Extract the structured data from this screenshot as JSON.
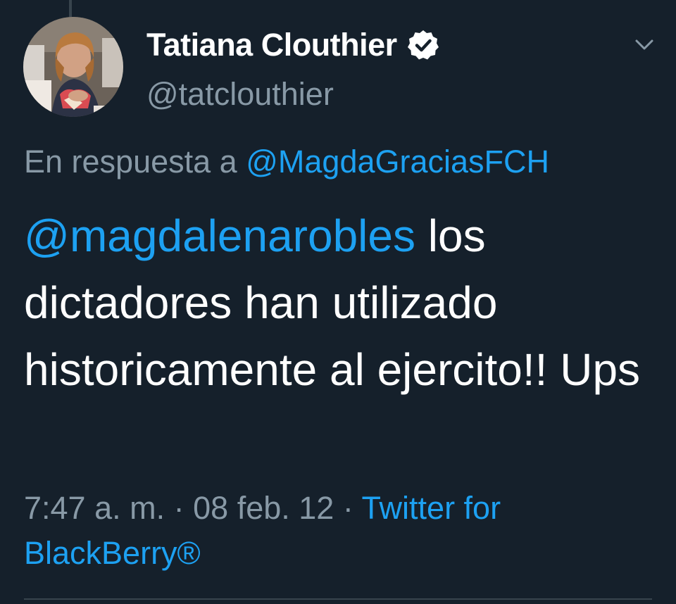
{
  "colors": {
    "background": "#15202b",
    "text": "#ffffff",
    "muted": "#8899a6",
    "link": "#1da1f2",
    "divider": "#38444d"
  },
  "author": {
    "display_name": "Tatiana Clouthier",
    "handle": "@tatclouthier",
    "verified_icon": "verified-badge-icon",
    "avatar": "avatar-photo"
  },
  "header": {
    "menu_icon": "chevron-down-icon"
  },
  "reply": {
    "prefix": "En respuesta a",
    "to": "@MagdaGraciasFCH"
  },
  "tweet": {
    "mention": "@magdalenarobles",
    "text": " los dictadores han utilizado historicamente al ejercito!! Ups"
  },
  "meta": {
    "time": "7:47 a. m.",
    "separator": "·",
    "date": "08 feb. 12",
    "source": "Twitter for BlackBerry®"
  }
}
